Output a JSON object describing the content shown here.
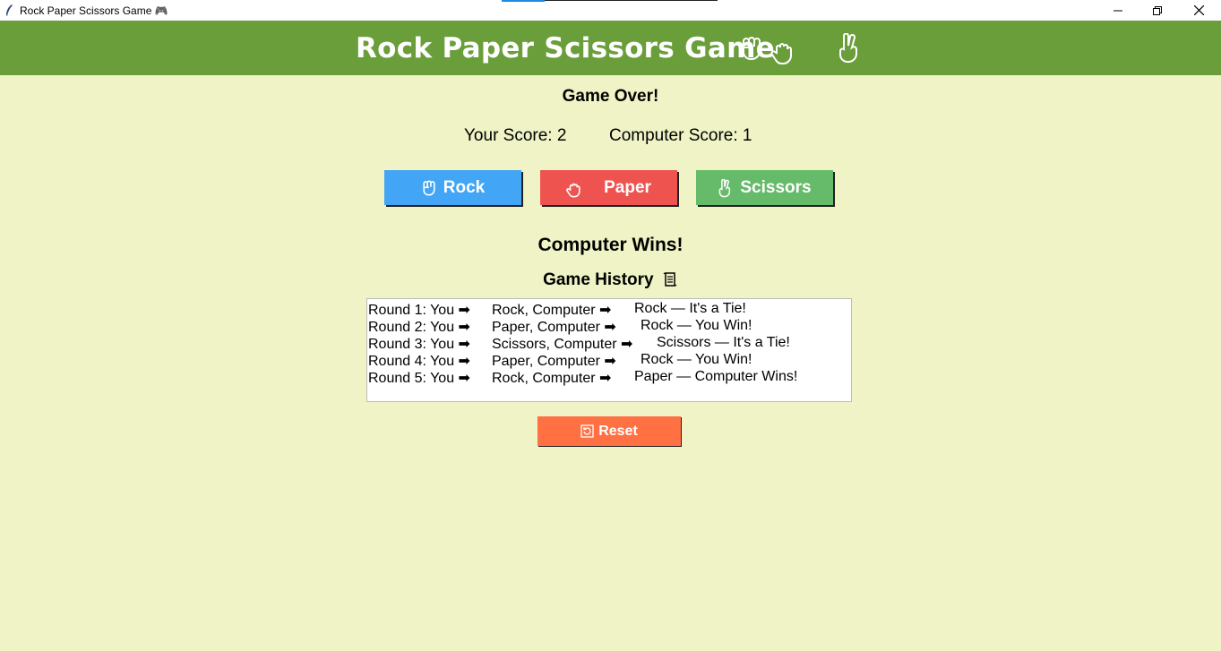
{
  "window": {
    "title": "Rock Paper Scissors Game 🎮",
    "controls": [
      "minimize",
      "maximize",
      "close"
    ]
  },
  "header": {
    "title": "Rock Paper Scissors Game",
    "icons": [
      "fist-icon",
      "hand-icon",
      "peace-hand-icon"
    ],
    "color": "#6a9e3a"
  },
  "status": "Game Over!",
  "scores": {
    "you": "Your Score: 2",
    "computer": "Computer Score: 1"
  },
  "buttons": {
    "rock": "Rock",
    "paper": "Paper",
    "scissors": "Scissors",
    "rock_color": "#42a5f5",
    "paper_color": "#ef5350",
    "scissors_color": "#66bb6a"
  },
  "result": "Computer Wins!",
  "history": {
    "title": "Game History",
    "rounds": [
      {
        "a": "Round 1: You ➡",
        "b": "Rock, Computer ➡",
        "c": "Rock — It's a Tie!"
      },
      {
        "a": "Round 2: You ➡",
        "b": "Paper, Computer ➡",
        "c": "Rock — You Win!"
      },
      {
        "a": "Round 3: You ➡",
        "b": "Scissors, Computer ➡",
        "c": "Scissors — It's a Tie!"
      },
      {
        "a": "Round 4: You ➡",
        "b": "Paper, Computer ➡",
        "c": "Rock — You Win!"
      },
      {
        "a": "Round 5: You ➡",
        "b": "Rock, Computer ➡",
        "c": "Paper — Computer Wins!"
      }
    ]
  },
  "reset": {
    "label": "Reset",
    "color": "#ff7043"
  },
  "background": "#eff3c5"
}
